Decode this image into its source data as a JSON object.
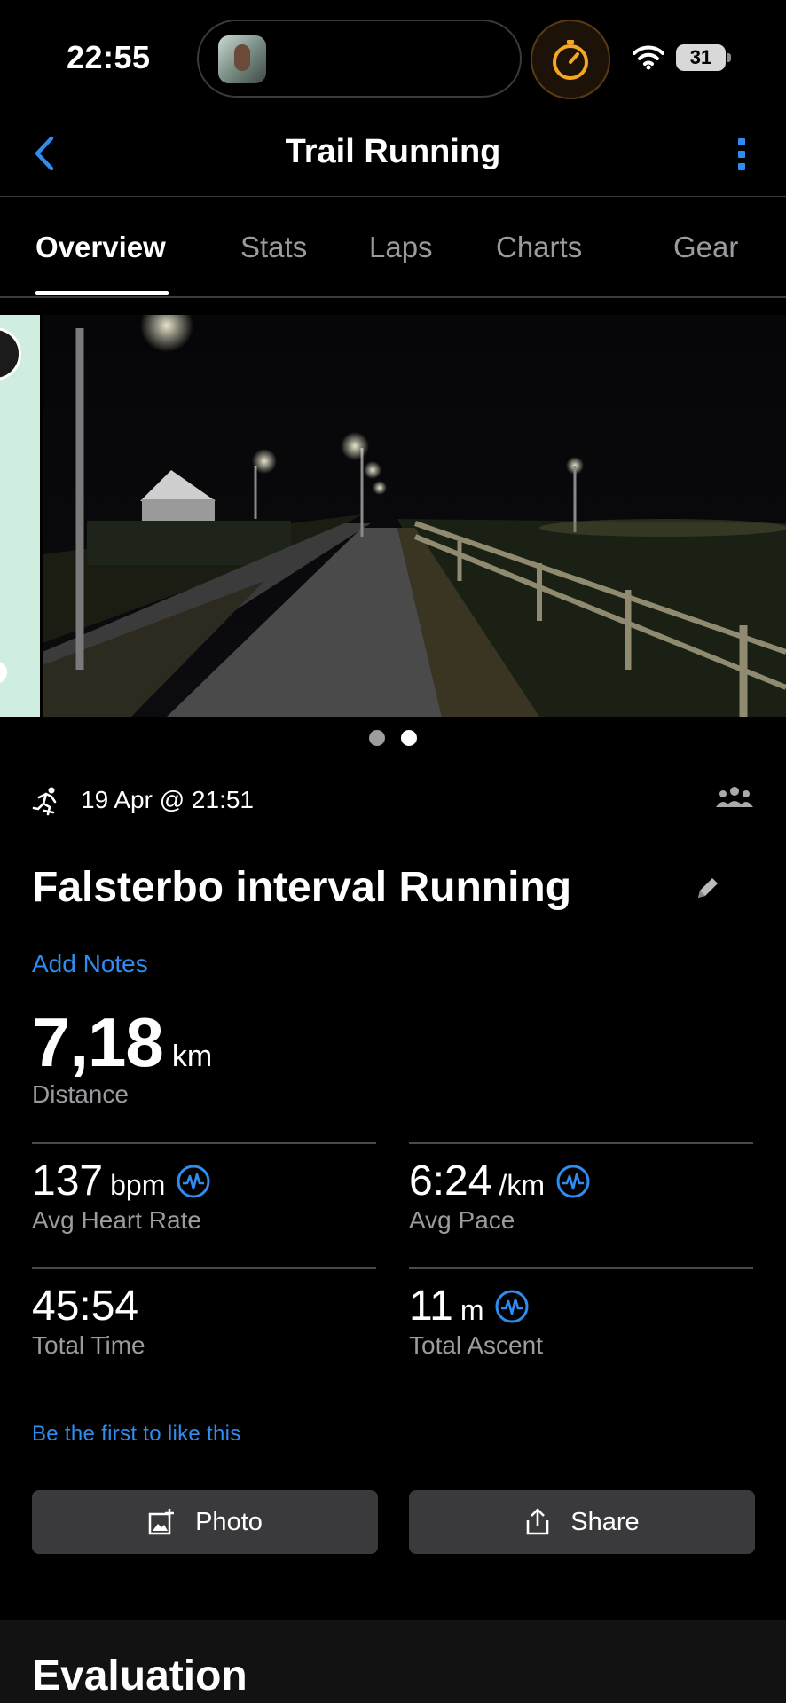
{
  "status_bar": {
    "time": "22:55",
    "battery": "31",
    "icons": [
      "now-playing-thumbnail",
      "stopwatch-icon",
      "wifi-icon",
      "battery-icon"
    ],
    "accent_timer": "#f5a623"
  },
  "nav": {
    "title": "Trail Running",
    "back_icon": "chevron-left-icon",
    "more_icon": "vertical-dots-icon"
  },
  "tabs": [
    {
      "label": "Overview",
      "active": true
    },
    {
      "label": "Stats",
      "active": false
    },
    {
      "label": "Laps",
      "active": false
    },
    {
      "label": "Charts",
      "active": false
    },
    {
      "label": "Gear",
      "active": false
    }
  ],
  "media": {
    "items": [
      "map",
      "photo"
    ],
    "current_page": 2,
    "page_count": 2
  },
  "activity": {
    "datetime": "19 Apr @ 21:51",
    "name": "Falsterbo interval Running",
    "add_notes": "Add Notes",
    "distance": {
      "value": "7,18",
      "unit": "km",
      "label": "Distance"
    },
    "stats": [
      {
        "value": "137",
        "unit": "bpm",
        "label": "Avg Heart Rate",
        "badge": true
      },
      {
        "value": "6:24",
        "unit": "/km",
        "label": "Avg Pace",
        "badge": true
      },
      {
        "value": "45:54",
        "unit": "",
        "label": "Total Time",
        "badge": false
      },
      {
        "value": "11",
        "unit": "m",
        "label": "Total Ascent",
        "badge": true
      }
    ],
    "like_text": "Be the first to like this"
  },
  "buttons": {
    "photo": "Photo",
    "share": "Share"
  },
  "evaluation": {
    "title": "Evaluation"
  },
  "colors": {
    "accent": "#2f8cf0",
    "background": "#000000",
    "button": "#3a3a3c",
    "secondary_text": "#9b9b9f"
  }
}
